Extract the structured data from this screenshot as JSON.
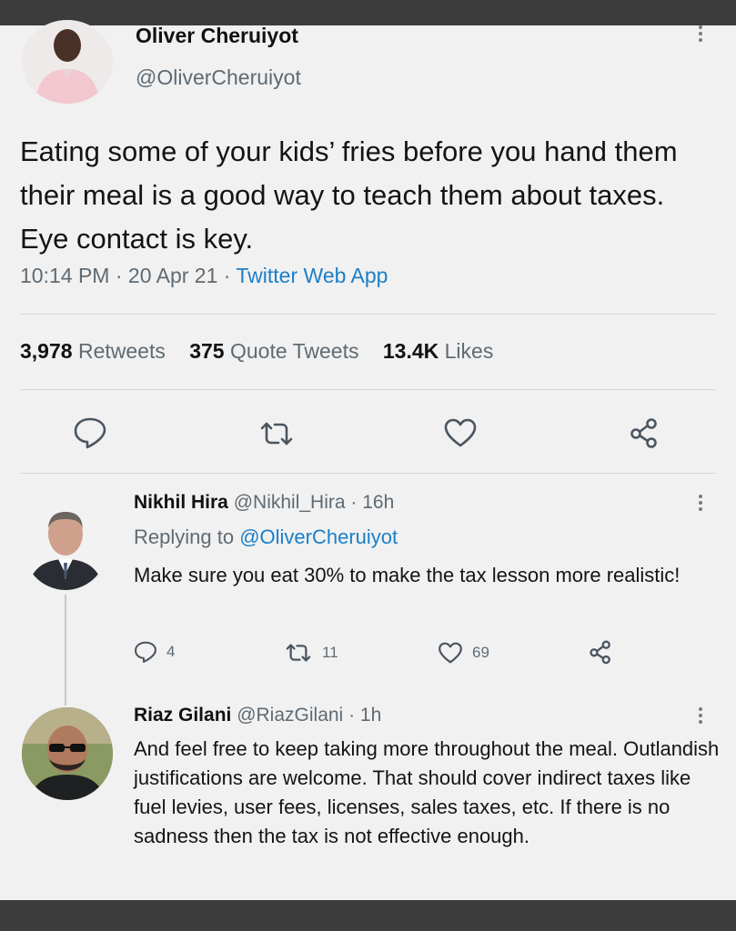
{
  "main_tweet": {
    "author_name": "Oliver Cheruiyot",
    "author_handle": "@OliverCheruiyot",
    "text": "Eating some of your kids’ fries before you hand them their meal is a good way to teach them about taxes. Eye contact is key.",
    "time": "10:14 PM",
    "date": "20 Apr 21",
    "source": "Twitter Web App",
    "stats": {
      "retweets_count": "3,978",
      "retweets_label": "Retweets",
      "quotes_count": "375",
      "quotes_label": "Quote Tweets",
      "likes_count": "13.4K",
      "likes_label": "Likes"
    },
    "actions": [
      "reply-icon",
      "retweet-icon",
      "like-icon",
      "share-icon"
    ]
  },
  "replies": [
    {
      "author_name": "Nikhil Hira",
      "author_handle": "@Nikhil_Hira",
      "age": "16h",
      "replying_prefix": "Replying to",
      "replying_to": "@OliverCheruiyot",
      "text": "Make sure you eat 30% to make the tax lesson more realistic!",
      "reply_count": "4",
      "retweet_count": "11",
      "like_count": "69"
    },
    {
      "author_name": "Riaz Gilani",
      "author_handle": "@RiazGilani",
      "age": "1h",
      "text": "And feel free to keep taking more throughout the meal. Outlandish justifications are welcome. That should cover indirect taxes like fuel levies, user fees, licenses, sales taxes, etc. If there is no sadness then the tax is not effective enough."
    }
  ],
  "separator": " · ",
  "colors": {
    "link": "#1b7fc7",
    "muted": "#5f6a73",
    "frame": "#3c3c3c",
    "background": "#f1f1f1"
  }
}
